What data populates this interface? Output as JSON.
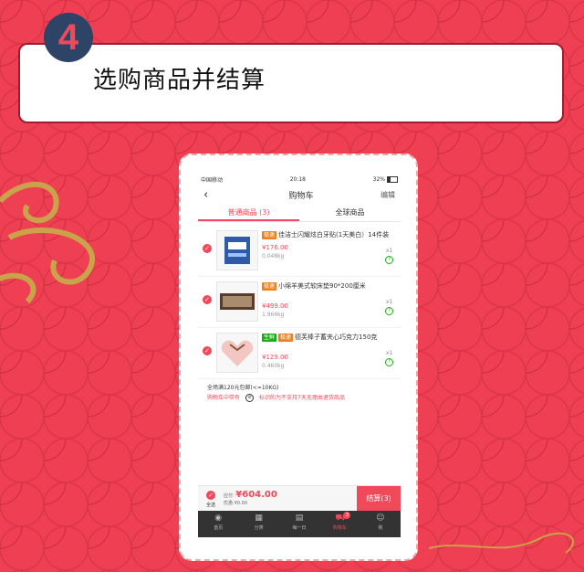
{
  "step": {
    "number": "4",
    "title": "选购商品并结算"
  },
  "colors": {
    "background": "#ef3f52",
    "accent": "#f0495a",
    "step_circle": "#2d4467"
  },
  "phone": {
    "status": {
      "carrier": "中国移动",
      "time": "20:18",
      "battery": "32%"
    },
    "nav": {
      "back_icon": "chevron-left-icon",
      "title": "购物车",
      "edit": "编辑"
    },
    "tabs": [
      {
        "label": "普通商品 (3)",
        "active": true
      },
      {
        "label": "全球商品",
        "active": false
      }
    ],
    "items": [
      {
        "tags": [
          "极速"
        ],
        "name": "佳洁士闪耀炫白牙贴(1天美白）14件装",
        "price": "¥176.00",
        "weight": "0.048kg",
        "qty": "x1"
      },
      {
        "tags": [
          "极速"
        ],
        "name": "小绵羊美式软床垫90*200厘米",
        "price": "¥499.00",
        "weight": "1.966kg",
        "qty": "x1"
      },
      {
        "tags": [
          "生鲜",
          "极速"
        ],
        "name": "德芙棒子蓄夹心巧克力150克",
        "price": "¥129.00",
        "weight": "0.460kg",
        "qty": "x1"
      }
    ],
    "promo": {
      "line1": "全场满120元包邮(<=10KG)",
      "link1": "购物车中带有",
      "link2": "标识的为不支持7天无理由退货商品"
    },
    "checkout": {
      "select_all": "全选",
      "payable_label": "应付:",
      "total": "¥604.00",
      "discount_label": "优惠:",
      "discount": "¥0.00",
      "settle": "结算(3)"
    },
    "tabbar": [
      {
        "label": "首页",
        "icon": "eye-icon",
        "active": false
      },
      {
        "label": "分类",
        "icon": "grid-icon",
        "active": false
      },
      {
        "label": "每一日",
        "icon": "calendar-icon",
        "active": false
      },
      {
        "label": "购物车",
        "icon": "cart-icon",
        "active": true,
        "badge": "3"
      },
      {
        "label": "我",
        "icon": "user-icon",
        "active": false
      }
    ]
  }
}
